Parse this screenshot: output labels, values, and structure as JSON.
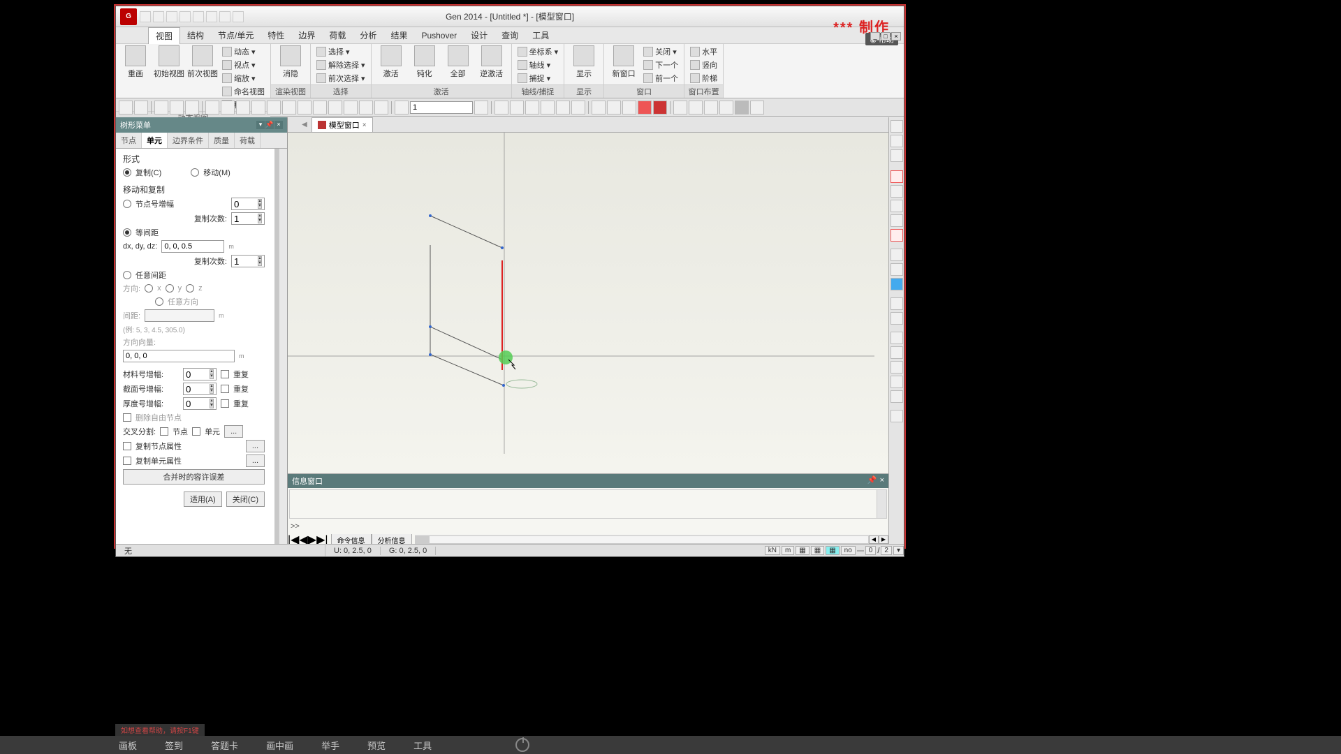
{
  "title": "Gen 2014 - [Untitled *] - [模型窗口]",
  "watermark": "*** 制作",
  "help": "帮助",
  "qat_count": 8,
  "menu": {
    "items": [
      "视图",
      "结构",
      "节点/单元",
      "特性",
      "边界",
      "荷载",
      "分析",
      "结果",
      "Pushover",
      "设计",
      "查询",
      "工具"
    ],
    "active": 0
  },
  "ribbon": {
    "groups": [
      {
        "label": "动态视图",
        "big": [
          {
            "l": "重画"
          },
          {
            "l": "初始视图"
          },
          {
            "l": "前次视图"
          }
        ],
        "small": [
          {
            "l": "动态 ▾"
          },
          {
            "l": "视点 ▾"
          },
          {
            "l": "缩放 ▾"
          },
          {
            "l": "命名视图"
          },
          {
            "l": "移动 ▾"
          }
        ]
      },
      {
        "label": "渲染视图",
        "big": [
          {
            "l": "消隐"
          }
        ],
        "small": []
      },
      {
        "label": "选择",
        "big": [],
        "small": [
          {
            "l": "选择 ▾"
          },
          {
            "l": "解除选择 ▾"
          },
          {
            "l": "前次选择 ▾"
          }
        ]
      },
      {
        "label": "激活",
        "big": [
          {
            "l": "激活"
          },
          {
            "l": "钝化"
          },
          {
            "l": "全部"
          },
          {
            "l": "逆激活"
          }
        ],
        "small": []
      },
      {
        "label": "轴线/捕捉",
        "big": [],
        "small": [
          {
            "l": "坐标系 ▾"
          },
          {
            "l": "轴线 ▾"
          },
          {
            "l": "捕捉 ▾"
          }
        ]
      },
      {
        "label": "显示",
        "big": [
          {
            "l": "显示"
          }
        ],
        "small": []
      },
      {
        "label": "窗口",
        "big": [
          {
            "l": "新窗口"
          }
        ],
        "small": [
          {
            "l": "关闭 ▾"
          },
          {
            "l": "下一个"
          },
          {
            "l": "前一个"
          }
        ]
      },
      {
        "label": "窗口布置",
        "big": [],
        "small": [
          {
            "l": "水平"
          },
          {
            "l": "竖向"
          },
          {
            "l": "阶梯"
          }
        ]
      }
    ]
  },
  "toolbar2": {
    "input": "1"
  },
  "left": {
    "title": "树形菜单",
    "tabs": [
      "节点",
      "单元",
      "边界条件",
      "质量",
      "荷载"
    ],
    "active_tab": 1,
    "form": {
      "shape_label": "形式",
      "copy": "复制(C)",
      "move": "移动(M)",
      "move_copy": "移动和复制",
      "node_incr": "节点号增幅",
      "node_incr_val": "0",
      "copy_times": "复制次数:",
      "copy_times_val1": "1",
      "equal_dist": "等间距",
      "dxdydz": "dx, dy, dz:",
      "dxdydz_val": "0, 0, 0.5",
      "copy_times_val2": "1",
      "arbitrary": "任意间距",
      "dir": "方向:",
      "dx": "x",
      "dy": "y",
      "dz": "z",
      "darb": "任意方向",
      "gap": "间距:",
      "eg": "(例: 5, 3, 4.5, 305.0)",
      "dirvec": "方向向量:",
      "dirvec_val": "0, 0, 0",
      "mat_incr": "材料号增幅:",
      "mat_val": "0",
      "sec_incr": "截面号增幅:",
      "sec_val": "0",
      "thk_incr": "厚度号增幅:",
      "thk_val": "0",
      "repeat": "重复",
      "delfree": "删除自由节点",
      "cross": "交叉分割:",
      "cross_node": "节点",
      "cross_elem": "单元",
      "copy_node_attr": "复制节点属性",
      "copy_elem_attr": "复制单元属性",
      "merge_tol": "合并时的容许误差",
      "apply": "适用(A)",
      "close": "关闭(C)"
    }
  },
  "doctab": {
    "label": "模型窗口"
  },
  "info": {
    "title": "信息窗口",
    "prompt": ">>",
    "tabs": [
      "命令信息",
      "分析信息"
    ]
  },
  "status": {
    "u": "U: 0, 2.5, 0",
    "g": "G: 0, 2.5, 0",
    "mid": "无",
    "right": [
      "kN",
      "m",
      "",
      "",
      "",
      "no",
      "0",
      "/",
      "2"
    ]
  },
  "hint": "如想查看帮助，请按F1键",
  "bottombar": [
    "画板",
    "签到",
    "答题卡",
    "画中画",
    "举手",
    "预览",
    "工具"
  ]
}
